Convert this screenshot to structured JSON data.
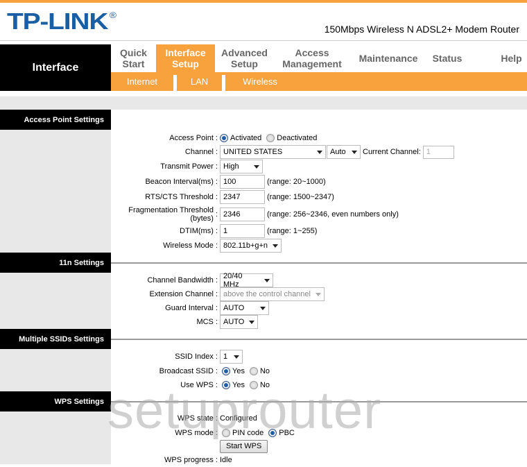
{
  "header": {
    "logo": "TP-LINK",
    "logo_mark": "®",
    "model": "150Mbps Wireless N ADSL2+ Modem Router",
    "accent_color": "#f7a23c",
    "logo_color": "#1a5fa3"
  },
  "side_title": "Interface",
  "menu": [
    {
      "line1": "Quick",
      "line2": "Start",
      "active": false
    },
    {
      "line1": "Interface",
      "line2": "Setup",
      "active": true
    },
    {
      "line1": "Advanced",
      "line2": "Setup",
      "active": false
    },
    {
      "line1": "Access",
      "line2": "Management",
      "active": false
    },
    {
      "line1": "Maintenance",
      "line2": "",
      "active": false
    },
    {
      "line1": "Status",
      "line2": "",
      "active": false
    },
    {
      "line1": "Help",
      "line2": "",
      "active": false
    }
  ],
  "submenu": [
    "Internet",
    "LAN",
    "Wireless"
  ],
  "sections": {
    "ap": {
      "title": "Access Point Settings",
      "access_point": {
        "label": "Access Point :",
        "opt1": "Activated",
        "opt2": "Deactivated",
        "selected": "Activated"
      },
      "channel": {
        "label": "Channel :",
        "country": "UNITED STATES",
        "channel": "Auto",
        "current_label": "Current Channel:",
        "current_value": "1"
      },
      "transmit_power": {
        "label": "Transmit Power :",
        "value": "High"
      },
      "beacon": {
        "label": "Beacon Interval(ms) :",
        "value": "100",
        "hint": "(range: 20~1000)"
      },
      "rts": {
        "label": "RTS/CTS Threshold :",
        "value": "2347",
        "hint": "(range: 1500~2347)"
      },
      "frag": {
        "label1": "Fragmentation Threshold",
        "label2": "(bytes)",
        "colon": ":",
        "value": "2346",
        "hint": "(range: 256~2346, even numbers only)"
      },
      "dtim": {
        "label": "DTIM(ms) :",
        "value": "1",
        "hint": "(range: 1~255)"
      },
      "mode": {
        "label": "Wireless Mode :",
        "value": "802.11b+g+n"
      }
    },
    "n": {
      "title": "11n Settings",
      "bandwidth": {
        "label": "Channel Bandwidth :",
        "value": "20/40 MHz"
      },
      "extension": {
        "label": "Extension Channel :",
        "value": "above the control channel"
      },
      "guard": {
        "label": "Guard Interval :",
        "value": "AUTO"
      },
      "mcs": {
        "label": "MCS :",
        "value": "AUTO"
      }
    },
    "ssid": {
      "title": "Multiple SSIDs Settings",
      "index": {
        "label": "SSID Index :",
        "value": "1"
      },
      "broadcast": {
        "label": "Broadcast SSID :",
        "opt1": "Yes",
        "opt2": "No",
        "selected": "Yes"
      },
      "wps": {
        "label": "Use WPS :",
        "opt1": "Yes",
        "opt2": "No",
        "selected": "Yes"
      }
    },
    "wps": {
      "title": "WPS Settings",
      "state": {
        "label": "WPS state :",
        "value": "Configured"
      },
      "mode": {
        "label": "WPS mode :",
        "opt1": "PIN code",
        "opt2": "PBC",
        "selected": "PBC"
      },
      "start_button": "Start WPS",
      "progress": {
        "label": "WPS progress :",
        "value": "Idle"
      }
    }
  },
  "watermark": "setuprouter"
}
